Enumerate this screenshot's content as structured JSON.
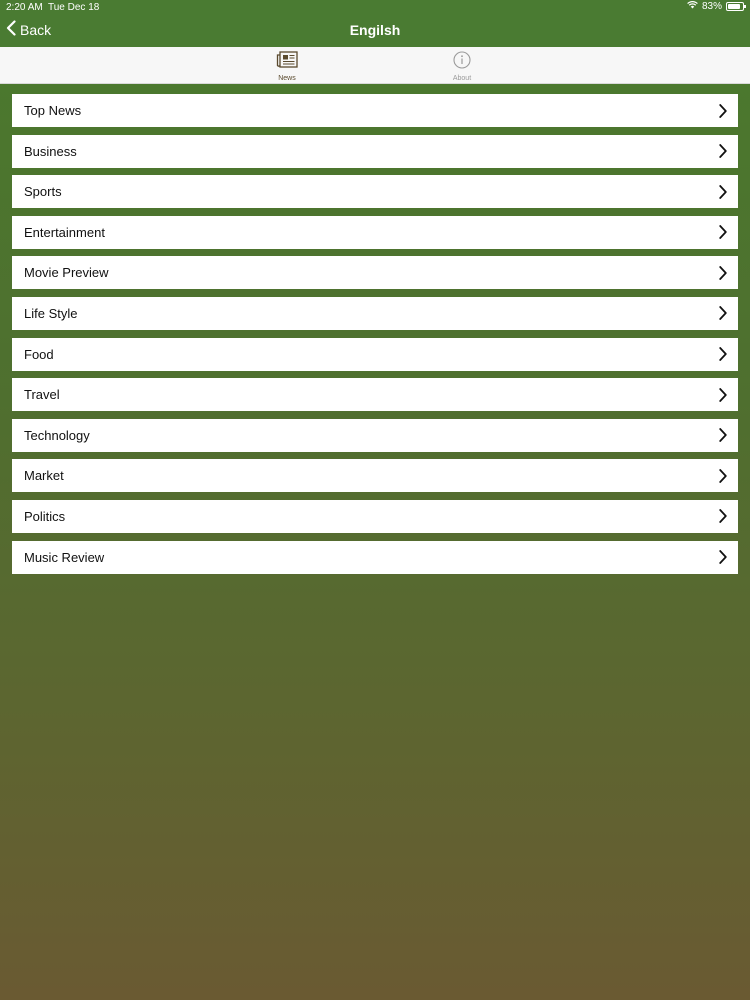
{
  "status_bar": {
    "time": "2:20 AM",
    "date": "Tue Dec 18",
    "battery": "83%",
    "battery_level": 0.83
  },
  "nav": {
    "back_label": "Back",
    "title": "Engilsh"
  },
  "tabs": [
    {
      "label": "News",
      "icon": "newspaper-icon",
      "active": true
    },
    {
      "label": "About",
      "icon": "info-icon",
      "active": false
    }
  ],
  "categories": [
    {
      "label": "Top News"
    },
    {
      "label": "Business"
    },
    {
      "label": "Sports"
    },
    {
      "label": "Entertainment"
    },
    {
      "label": "Movie Preview"
    },
    {
      "label": "Life Style"
    },
    {
      "label": "Food"
    },
    {
      "label": "Travel"
    },
    {
      "label": "Technology"
    },
    {
      "label": "Market"
    },
    {
      "label": "Politics"
    },
    {
      "label": "Music Review"
    }
  ],
  "colors": {
    "nav_bar": "#4a7b32",
    "active_tab": "#5a4a2e",
    "inactive_tab": "#9a9a9a"
  }
}
